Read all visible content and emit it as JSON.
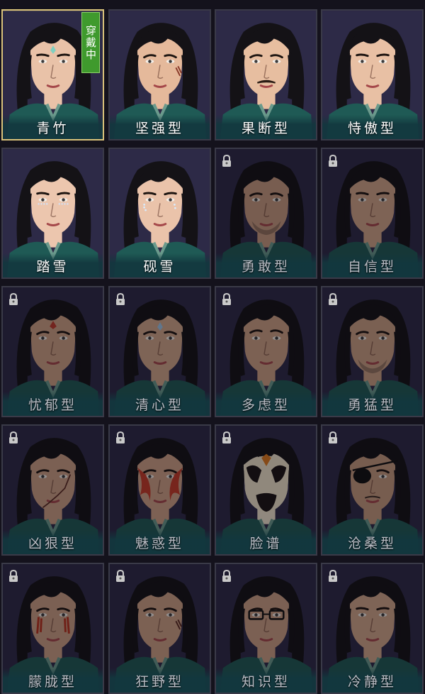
{
  "grid": {
    "cards": [
      {
        "id": "qingzhu",
        "label": "青竹",
        "selected": true,
        "locked": false,
        "badge": "穿戴中",
        "skin": "#e9c2a8",
        "mark": "forehead-jewel",
        "markColor": "#7fd0c0",
        "brow": "soft"
      },
      {
        "id": "jianqiang",
        "label": "坚强型",
        "selected": false,
        "locked": false,
        "skin": "#e5b99b",
        "mark": "cheek-scar",
        "markColor": "#8a3a2a",
        "brow": "sharp"
      },
      {
        "id": "guoduan",
        "label": "果断型",
        "selected": false,
        "locked": false,
        "skin": "#e7bea0",
        "mark": "mustache",
        "markColor": "#2a1c14",
        "brow": "sharp"
      },
      {
        "id": "shiao",
        "label": "恃傲型",
        "selected": false,
        "locked": false,
        "skin": "#e8c0a4",
        "mark": "none",
        "markColor": "#000000",
        "brow": "soft"
      },
      {
        "id": "taxue",
        "label": "踏雪",
        "selected": false,
        "locked": false,
        "skin": "#ecc6ae",
        "mark": "eye-dots",
        "markColor": "#cfe4ff",
        "brow": "soft"
      },
      {
        "id": "yanxue",
        "label": "砚雪",
        "selected": false,
        "locked": false,
        "skin": "#eac3aa",
        "mark": "tear-dots",
        "markColor": "#d8ecff",
        "brow": "soft"
      },
      {
        "id": "yonggan",
        "label": "勇敢型",
        "selected": false,
        "locked": true,
        "skin": "#c89c80",
        "mark": "stubble",
        "markColor": "#3a2a22",
        "brow": "sharp"
      },
      {
        "id": "zixin",
        "label": "自信型",
        "selected": false,
        "locked": true,
        "skin": "#d2a688",
        "mark": "none",
        "markColor": "#000000",
        "brow": "soft"
      },
      {
        "id": "youyu",
        "label": "忧郁型",
        "selected": false,
        "locked": true,
        "skin": "#cfa386",
        "mark": "forehead-red",
        "markColor": "#c0392b",
        "brow": "sharp"
      },
      {
        "id": "qingxin",
        "label": "清心型",
        "selected": false,
        "locked": true,
        "skin": "#d3a88b",
        "mark": "forehead-jewel",
        "markColor": "#9fc6e8",
        "brow": "sharp"
      },
      {
        "id": "duolv",
        "label": "多虑型",
        "selected": false,
        "locked": true,
        "skin": "#cfa386",
        "mark": "none",
        "markColor": "#000000",
        "brow": "frown"
      },
      {
        "id": "yongmeng",
        "label": "勇猛型",
        "selected": false,
        "locked": true,
        "skin": "#cba084",
        "mark": "stubble",
        "markColor": "#3a2a22",
        "brow": "sharp"
      },
      {
        "id": "xionghen",
        "label": "凶狠型",
        "selected": false,
        "locked": true,
        "skin": "#cda185",
        "mark": "long-scar",
        "markColor": "#5a2a22",
        "brow": "sharp"
      },
      {
        "id": "meihuo",
        "label": "魅惑型",
        "selected": false,
        "locked": true,
        "skin": "#d0a387",
        "mark": "flame-paint",
        "markColor": "#c4301e",
        "brow": "sharp"
      },
      {
        "id": "lianpu",
        "label": "脸谱",
        "selected": false,
        "locked": true,
        "skin": "#f2e6cf",
        "mark": "opera-mask",
        "markColor": "#e07a1e",
        "brow": "sharp"
      },
      {
        "id": "cangsang",
        "label": "沧桑型",
        "selected": false,
        "locked": true,
        "skin": "#c79b7f",
        "mark": "eyepatch",
        "markColor": "#111111",
        "brow": "sharp"
      },
      {
        "id": "menglong",
        "label": "朦胧型",
        "selected": false,
        "locked": true,
        "skin": "#cda185",
        "mark": "red-stripes",
        "markColor": "#b8321e",
        "brow": "sharp"
      },
      {
        "id": "kuangye",
        "label": "狂野型",
        "selected": false,
        "locked": true,
        "skin": "#cfa386",
        "mark": "cheek-scar",
        "markColor": "#5a2a22",
        "brow": "sharp"
      },
      {
        "id": "zhishi",
        "label": "知识型",
        "selected": false,
        "locked": true,
        "skin": "#cda185",
        "mark": "glasses",
        "markColor": "#111111",
        "brow": "sharp"
      },
      {
        "id": "lengjing",
        "label": "冷静型",
        "selected": false,
        "locked": true,
        "skin": "#d2a78a",
        "mark": "none",
        "markColor": "#000000",
        "brow": "soft"
      }
    ]
  },
  "colors": {
    "hair": "#141216",
    "robe": "#1f5a55",
    "robeTrim": "#6a9a8c",
    "bg": "#2d2a47",
    "badge": "#3f9a2d",
    "selectedBorder": "#d9c27a"
  }
}
